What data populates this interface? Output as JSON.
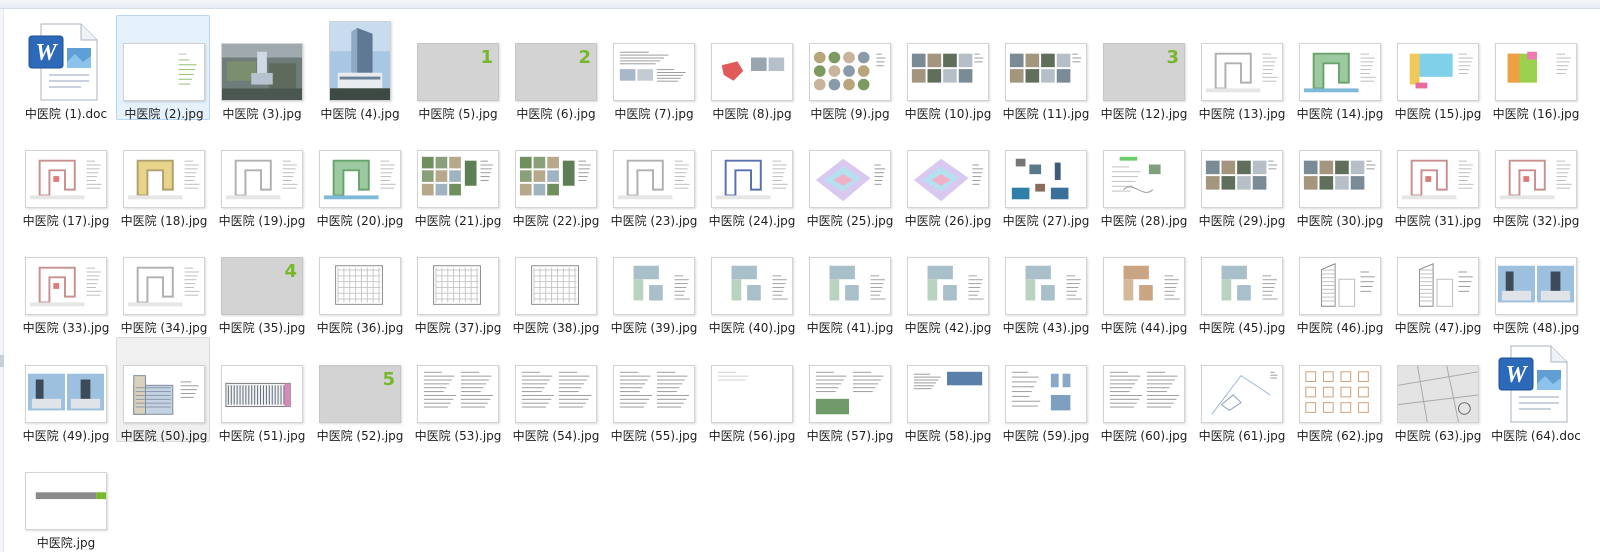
{
  "files": [
    {
      "name": "中医院 (1).doc",
      "thumb": "word"
    },
    {
      "name": "中医院 (2).jpg",
      "thumb": "toc",
      "state": "selected"
    },
    {
      "name": "中医院 (3).jpg",
      "thumb": "aerial"
    },
    {
      "name": "中医院 (4).jpg",
      "thumb": "tower"
    },
    {
      "name": "中医院 (5).jpg",
      "thumb": "separator",
      "num": "1"
    },
    {
      "name": "中医院 (6).jpg",
      "thumb": "separator",
      "num": "2"
    },
    {
      "name": "中医院 (7).jpg",
      "thumb": "textphoto"
    },
    {
      "name": "中医院 (8).jpg",
      "thumb": "mapred"
    },
    {
      "name": "中医院 (9).jpg",
      "thumb": "circles"
    },
    {
      "name": "中医院 (10).jpg",
      "thumb": "photos"
    },
    {
      "name": "中医院 (11).jpg",
      "thumb": "photos"
    },
    {
      "name": "中医院 (12).jpg",
      "thumb": "separator",
      "num": "3"
    },
    {
      "name": "中医院 (13).jpg",
      "thumb": "plan"
    },
    {
      "name": "中医院 (14).jpg",
      "thumb": "plangreen"
    },
    {
      "name": "中医院 (15).jpg",
      "thumb": "plancolor"
    },
    {
      "name": "中医院 (16).jpg",
      "thumb": "plancolor2"
    },
    {
      "name": "中医院 (17).jpg",
      "thumb": "planred"
    },
    {
      "name": "中医院 (18).jpg",
      "thumb": "planyellow"
    },
    {
      "name": "中医院 (19).jpg",
      "thumb": "plan"
    },
    {
      "name": "中医院 (20).jpg",
      "thumb": "plangreen"
    },
    {
      "name": "中医院 (21).jpg",
      "thumb": "photogrid"
    },
    {
      "name": "中医院 (22).jpg",
      "thumb": "photogrid"
    },
    {
      "name": "中医院 (23).jpg",
      "thumb": "plan"
    },
    {
      "name": "中医院 (24).jpg",
      "thumb": "planblue"
    },
    {
      "name": "中医院 (25).jpg",
      "thumb": "isometric"
    },
    {
      "name": "中医院 (26).jpg",
      "thumb": "isometric"
    },
    {
      "name": "中医院 (27).jpg",
      "thumb": "collage"
    },
    {
      "name": "中医院 (28).jpg",
      "thumb": "sketch"
    },
    {
      "name": "中医院 (29).jpg",
      "thumb": "photos"
    },
    {
      "name": "中医院 (30).jpg",
      "thumb": "photos"
    },
    {
      "name": "中医院 (31).jpg",
      "thumb": "planred"
    },
    {
      "name": "中医院 (32).jpg",
      "thumb": "planred"
    },
    {
      "name": "中医院 (33).jpg",
      "thumb": "planred"
    },
    {
      "name": "中医院 (34).jpg",
      "thumb": "plan"
    },
    {
      "name": "中医院 (35).jpg",
      "thumb": "separator",
      "num": "4"
    },
    {
      "name": "中医院 (36).jpg",
      "thumb": "floorplan"
    },
    {
      "name": "中医院 (37).jpg",
      "thumb": "floorplan"
    },
    {
      "name": "中医院 (38).jpg",
      "thumb": "floorplan"
    },
    {
      "name": "中医院 (39).jpg",
      "thumb": "floorcolor"
    },
    {
      "name": "中医院 (40).jpg",
      "thumb": "floorcolor"
    },
    {
      "name": "中医院 (41).jpg",
      "thumb": "floorcolor"
    },
    {
      "name": "中医院 (42).jpg",
      "thumb": "floorcolor"
    },
    {
      "name": "中医院 (43).jpg",
      "thumb": "floorcolor"
    },
    {
      "name": "中医院 (44).jpg",
      "thumb": "floorbrown"
    },
    {
      "name": "中医院 (45).jpg",
      "thumb": "floorcolor"
    },
    {
      "name": "中医院 (46).jpg",
      "thumb": "section"
    },
    {
      "name": "中医院 (47).jpg",
      "thumb": "section"
    },
    {
      "name": "中医院 (48).jpg",
      "thumb": "renders"
    },
    {
      "name": "中医院 (49).jpg",
      "thumb": "renders"
    },
    {
      "name": "中医院 (50).jpg",
      "thumb": "elevation",
      "state": "hover"
    },
    {
      "name": "中医院 (51).jpg",
      "thumb": "longelev"
    },
    {
      "name": "中医院 (52).jpg",
      "thumb": "separator",
      "num": "5"
    },
    {
      "name": "中医院 (53).jpg",
      "thumb": "text"
    },
    {
      "name": "中医院 (54).jpg",
      "thumb": "text"
    },
    {
      "name": "中医院 (55).jpg",
      "thumb": "text"
    },
    {
      "name": "中医院 (56).jpg",
      "thumb": "textlight"
    },
    {
      "name": "中医院 (57).jpg",
      "thumb": "textimage"
    },
    {
      "name": "中医院 (58).jpg",
      "thumb": "textblue"
    },
    {
      "name": "中医院 (59).jpg",
      "thumb": "diagram"
    },
    {
      "name": "中医院 (60).jpg",
      "thumb": "text"
    },
    {
      "name": "中医院 (61).jpg",
      "thumb": "siteline"
    },
    {
      "name": "中医院 (62).jpg",
      "thumb": "smallplans"
    },
    {
      "name": "中医院 (63).jpg",
      "thumb": "cadmap"
    },
    {
      "name": "中医院 (64).doc",
      "thumb": "word"
    },
    {
      "name": "中医院.jpg",
      "thumb": "banner"
    }
  ]
}
